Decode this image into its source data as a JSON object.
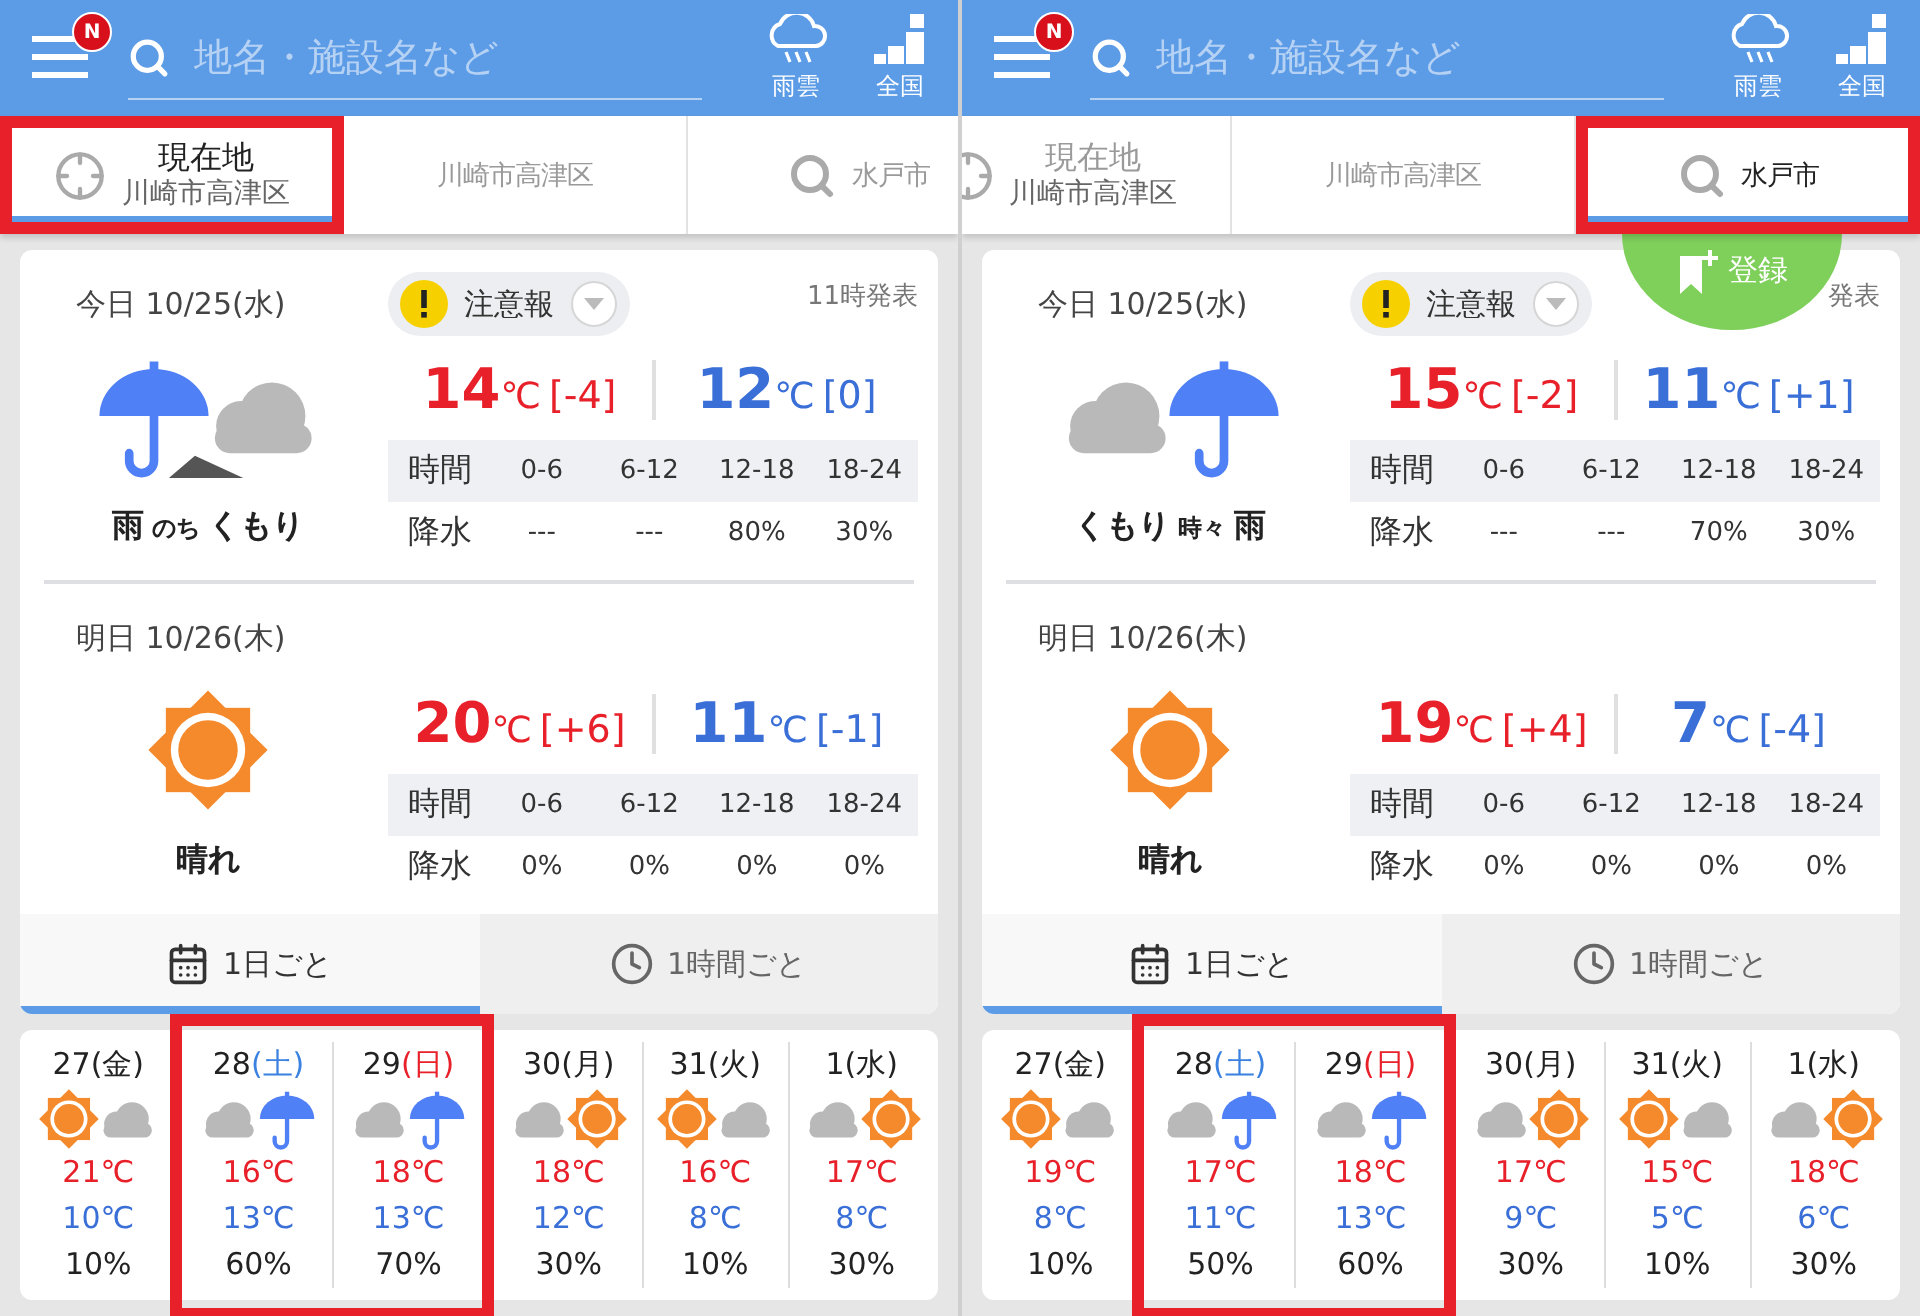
{
  "panels": [
    {
      "header": {
        "badge": "N",
        "placeholder": "地名・施設名など",
        "rain_label": "雨雲",
        "map_label": "全国"
      },
      "location_tabs": {
        "scrolled": false,
        "tabs": [
          {
            "kind": "current",
            "title": "現在地",
            "subtitle": "川崎市高津区",
            "selected": true,
            "highlighted": true
          },
          {
            "kind": "place",
            "title": "川崎市高津区",
            "selected": false,
            "highlighted": false
          },
          {
            "kind": "search",
            "title": "水戸市",
            "selected": false,
            "highlighted": false
          }
        ]
      },
      "forecast": {
        "days": [
          {
            "kind": "rain-then-cloudy",
            "date": "今日 10/25(水)",
            "warning": "注意報",
            "issued": "11時発表",
            "weather": [
              "雨",
              "のち",
              "くもり"
            ],
            "high": {
              "value": "14",
              "unit": "℃",
              "diff": "[-4]"
            },
            "low": {
              "value": "12",
              "unit": "℃",
              "diff": "[0]"
            },
            "table": {
              "header": [
                "時間",
                "0-6",
                "6-12",
                "12-18",
                "18-24"
              ],
              "row": [
                "降水",
                "---",
                "---",
                "80%",
                "30%"
              ]
            }
          },
          {
            "kind": "sunny",
            "date": "明日 10/26(木)",
            "weather": [
              "晴れ"
            ],
            "high": {
              "value": "20",
              "unit": "℃",
              "diff": "[+6]"
            },
            "low": {
              "value": "11",
              "unit": "℃",
              "diff": "[-1]"
            },
            "table": {
              "header": [
                "時間",
                "0-6",
                "6-12",
                "12-18",
                "18-24"
              ],
              "row": [
                "降水",
                "0%",
                "0%",
                "0%",
                "0%"
              ]
            }
          }
        ],
        "view_tabs": [
          {
            "kind": "calendar",
            "label": "1日ごと",
            "selected": true
          },
          {
            "kind": "clock",
            "label": "1時間ごと",
            "selected": false
          }
        ]
      },
      "weekly": [
        {
          "kind": "sunny-cloudy",
          "date": "27",
          "weekday": {
            "text": "(金)",
            "color": "#222222"
          },
          "high": "21℃",
          "low": "10℃",
          "pop": "10%",
          "highlighted": false
        },
        {
          "kind": "cloudy-rain",
          "date": "28",
          "weekday": {
            "text": "(土)",
            "color": "#3b82e0"
          },
          "high": "16℃",
          "low": "13℃",
          "pop": "60%",
          "highlighted": true
        },
        {
          "kind": "cloudy-rain",
          "date": "29",
          "weekday": {
            "text": "(日)",
            "color": "#e8202a"
          },
          "high": "18℃",
          "low": "13℃",
          "pop": "70%",
          "highlighted": true
        },
        {
          "kind": "cloudy-sunny",
          "date": "30",
          "weekday": {
            "text": "(月)",
            "color": "#222222"
          },
          "high": "18℃",
          "low": "12℃",
          "pop": "30%",
          "highlighted": false
        },
        {
          "kind": "sunny-cloudy",
          "date": "31",
          "weekday": {
            "text": "(火)",
            "color": "#222222"
          },
          "high": "16℃",
          "low": "8℃",
          "pop": "10%",
          "highlighted": false
        },
        {
          "kind": "cloudy-sunny",
          "date": "1",
          "weekday": {
            "text": "(水)",
            "color": "#222222"
          },
          "high": "17℃",
          "low": "8℃",
          "pop": "30%",
          "highlighted": false
        }
      ]
    },
    {
      "header": {
        "badge": "N",
        "placeholder": "地名・施設名など",
        "rain_label": "雨雲",
        "map_label": "全国"
      },
      "location_tabs": {
        "scrolled": true,
        "tabs": [
          {
            "kind": "current",
            "title": "現在地",
            "subtitle": "川崎市高津区",
            "selected": false,
            "highlighted": false
          },
          {
            "kind": "place",
            "title": "川崎市高津区",
            "selected": false,
            "highlighted": false
          },
          {
            "kind": "search",
            "title": "水戸市",
            "selected": true,
            "highlighted": true
          }
        ]
      },
      "register_button": {
        "label": "登録"
      },
      "forecast": {
        "days": [
          {
            "kind": "cloudy-sometimes-rain",
            "date": "今日 10/25(水)",
            "warning": "注意報",
            "issued": "発表",
            "weather": [
              "くもり",
              "時々",
              "雨"
            ],
            "high": {
              "value": "15",
              "unit": "℃",
              "diff": "[-2]"
            },
            "low": {
              "value": "11",
              "unit": "℃",
              "diff": "[+1]"
            },
            "table": {
              "header": [
                "時間",
                "0-6",
                "6-12",
                "12-18",
                "18-24"
              ],
              "row": [
                "降水",
                "---",
                "---",
                "70%",
                "30%"
              ]
            }
          },
          {
            "kind": "sunny",
            "date": "明日 10/26(木)",
            "weather": [
              "晴れ"
            ],
            "high": {
              "value": "19",
              "unit": "℃",
              "diff": "[+4]"
            },
            "low": {
              "value": "7",
              "unit": "℃",
              "diff": "[-4]"
            },
            "table": {
              "header": [
                "時間",
                "0-6",
                "6-12",
                "12-18",
                "18-24"
              ],
              "row": [
                "降水",
                "0%",
                "0%",
                "0%",
                "0%"
              ]
            }
          }
        ],
        "view_tabs": [
          {
            "kind": "calendar",
            "label": "1日ごと",
            "selected": true
          },
          {
            "kind": "clock",
            "label": "1時間ごと",
            "selected": false
          }
        ]
      },
      "weekly": [
        {
          "kind": "sunny-cloudy",
          "date": "27",
          "weekday": {
            "text": "(金)",
            "color": "#222222"
          },
          "high": "19℃",
          "low": "8℃",
          "pop": "10%",
          "highlighted": false
        },
        {
          "kind": "cloudy-rain",
          "date": "28",
          "weekday": {
            "text": "(土)",
            "color": "#3b82e0"
          },
          "high": "17℃",
          "low": "11℃",
          "pop": "50%",
          "highlighted": true
        },
        {
          "kind": "cloudy-rain",
          "date": "29",
          "weekday": {
            "text": "(日)",
            "color": "#e8202a"
          },
          "high": "18℃",
          "low": "13℃",
          "pop": "60%",
          "highlighted": true
        },
        {
          "kind": "cloudy-sunny",
          "date": "30",
          "weekday": {
            "text": "(月)",
            "color": "#222222"
          },
          "high": "17℃",
          "low": "9℃",
          "pop": "30%",
          "highlighted": false
        },
        {
          "kind": "sunny-cloudy",
          "date": "31",
          "weekday": {
            "text": "(火)",
            "color": "#222222"
          },
          "high": "15℃",
          "low": "5℃",
          "pop": "10%",
          "highlighted": false
        },
        {
          "kind": "cloudy-sunny",
          "date": "1",
          "weekday": {
            "text": "(水)",
            "color": "#222222"
          },
          "high": "18℃",
          "low": "6℃",
          "pop": "30%",
          "highlighted": false
        }
      ]
    }
  ]
}
